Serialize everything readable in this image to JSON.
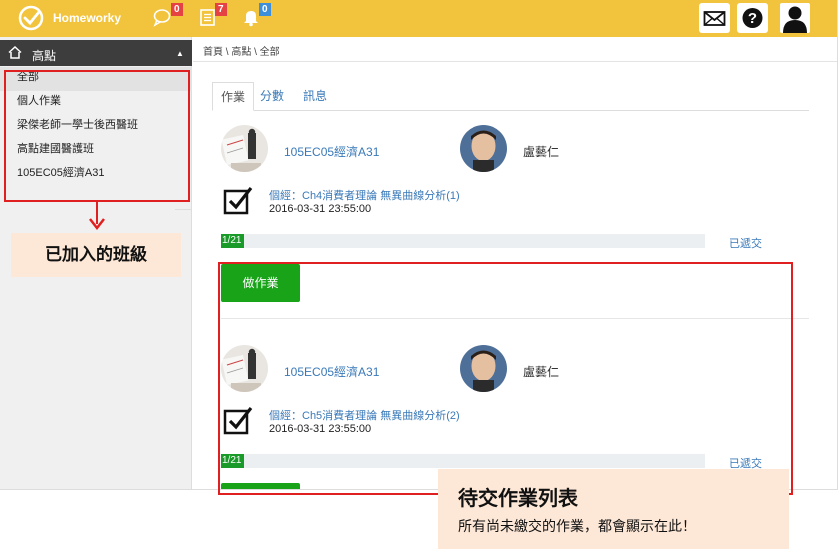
{
  "app": {
    "brand": "Homeworky",
    "badges": {
      "messages": "0",
      "notes": "7",
      "alerts": "0"
    },
    "colors": {
      "topbar": "#f2c43d",
      "link": "#3a79b8",
      "success": "#19a319",
      "annotation": "#e02020"
    }
  },
  "sidebar": {
    "header": "高點",
    "items": [
      {
        "label": "全部"
      },
      {
        "label": "個人作業"
      },
      {
        "label": "梁傑老師一學士後西醫班"
      },
      {
        "label": "高點建國醫護班"
      },
      {
        "label": "105EC05經濟A31"
      }
    ]
  },
  "breadcrumb": "首頁 \\ 高點 \\ 全部",
  "tabs": [
    {
      "label": "作業"
    },
    {
      "label": "分數"
    },
    {
      "label": "訊息"
    }
  ],
  "assignments": [
    {
      "course": "105EC05經濟A31",
      "teacher": "盧藝仁",
      "title": "個經：Ch4消費者理論 無異曲線分析(1)",
      "due": "2016-03-31 23:55:00",
      "progress_text": "1/21",
      "progress_fraction": 0.0476,
      "status": "已遞交",
      "button": "做作業"
    },
    {
      "course": "105EC05經濟A31",
      "teacher": "盧藝仁",
      "title": "個經：Ch5消費者理論 無異曲線分析(2)",
      "due": "2016-03-31 23:55:00",
      "progress_text": "1/21",
      "progress_fraction": 0.0476,
      "status": "已遞交",
      "button": ""
    }
  ],
  "annotations": {
    "classes_label": "已加入的班級",
    "pending_title": "待交作業列表",
    "pending_desc": "所有尚未繳交的作業，都會顯示在此！"
  }
}
